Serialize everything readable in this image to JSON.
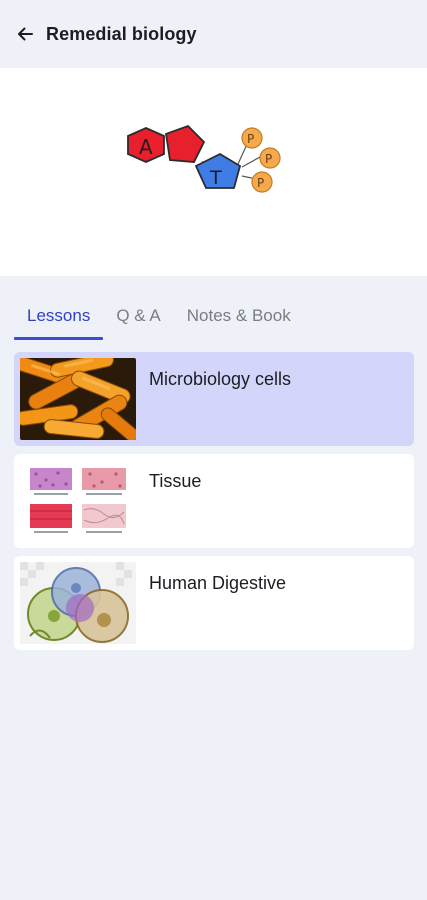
{
  "app_bar": {
    "title": "Remedial biology",
    "back_icon": "arrow-left-icon"
  },
  "hero": {
    "logo_letters": [
      "A",
      "T"
    ],
    "phosphate_letters": [
      "P",
      "P",
      "P"
    ]
  },
  "tabs": [
    {
      "label": "Lessons",
      "active": true
    },
    {
      "label": "Q & A",
      "active": false
    },
    {
      "label": "Notes & Book",
      "active": false
    }
  ],
  "lessons": [
    {
      "title": "Microbiology cells",
      "selected": true
    },
    {
      "title": "Tissue",
      "selected": false
    },
    {
      "title": "Human Digestive",
      "selected": false
    }
  ],
  "colors": {
    "background": "#eff1f9",
    "accent": "#3550d6",
    "selected_card": "#d3d5fb",
    "card": "#ffffff"
  }
}
